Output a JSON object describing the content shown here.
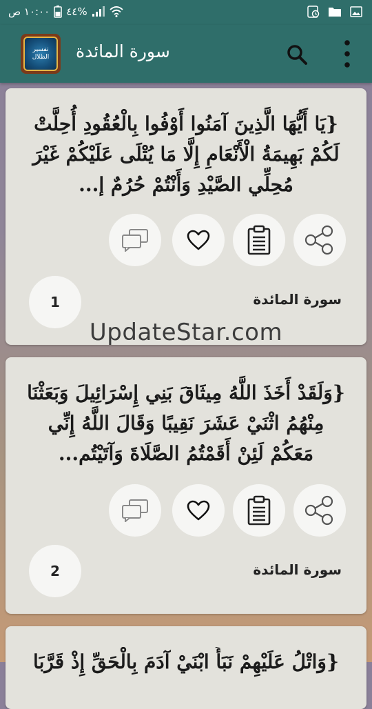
{
  "status": {
    "time": "١٠:٠٠ ص",
    "battery": "٤٤%"
  },
  "app": {
    "title": "سورة المائدة",
    "logo_line1": "تفسير",
    "logo_line2": "الظلال"
  },
  "cards": [
    {
      "verse": "{يَا أَيُّهَا الَّذِينَ آمَنُوا أَوْفُوا بِالْعُقُودِ أُحِلَّتْ لَكُمْ بَهِيمَةُ الْأَنْعَامِ إِلَّا مَا يُتْلَى عَلَيْكُمْ غَيْرَ مُحِلِّي الصَّيْدِ وَأَنْتُمْ حُرُمٌ إ...",
      "surah": "سورة المائدة",
      "number": "1"
    },
    {
      "verse": "{وَلَقَدْ أَخَذَ اللَّهُ مِيثَاقَ بَنِي إِسْرَائِيلَ وَبَعَثْنَا مِنْهُمُ اثْنَيْ عَشَرَ نَقِيبًا وَقَالَ اللَّهُ إِنِّي مَعَكُمْ لَئِنْ أَقَمْتُمُ الصَّلَاةَ وَآتَيْتُم...",
      "surah": "سورة المائدة",
      "number": "2"
    },
    {
      "verse": "{وَاتْلُ عَلَيْهِمْ نَبَأَ ابْنَيْ آدَمَ بِالْحَقِّ إِذْ قَرَّبَا"
    }
  ],
  "watermark": "UpdateStar.com",
  "colors": {
    "bar": "#2f6e6a",
    "card": "#e3e2dc",
    "action_bg": "#f6f6f4"
  },
  "icons": {
    "actions": [
      "share-icon",
      "clipboard-icon",
      "heart-icon",
      "comments-icon"
    ],
    "toolbar": [
      "search-icon",
      "more-vert-icon"
    ]
  }
}
